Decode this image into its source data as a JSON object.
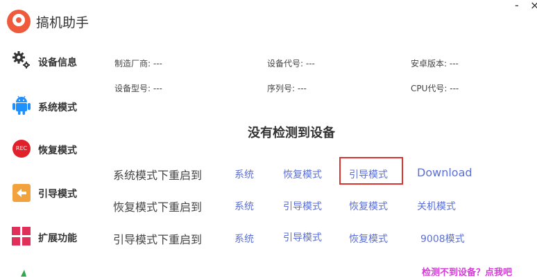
{
  "app": {
    "title": "搞机助手",
    "minimize": "-",
    "close": "×"
  },
  "sidebar": {
    "items": [
      {
        "label": "设备信息",
        "icon": "gears-icon"
      },
      {
        "label": "系统模式",
        "icon": "android-icon"
      },
      {
        "label": "恢复模式",
        "icon": "rec-icon",
        "icon_text": "REC"
      },
      {
        "label": "引导模式",
        "icon": "back-arrow-icon"
      },
      {
        "label": "扩展功能",
        "icon": "grid-icon"
      },
      {
        "label": "",
        "icon": "partial-icon"
      }
    ]
  },
  "device_info": {
    "manufacturer": "制造厂商: ---",
    "device_code": "设备代号: ---",
    "android_version": "安卓版本: ---",
    "model": "设备型号: ---",
    "serial": "序列号: ---",
    "cpu_code": "CPU代号: ---"
  },
  "status": {
    "no_device": "没有检测到设备"
  },
  "reboot_rows": [
    {
      "label": "系统模式下重启到",
      "options": [
        "系统",
        "恢复模式",
        "引导模式",
        "Download"
      ]
    },
    {
      "label": "恢复模式下重启到",
      "options": [
        "系统",
        "引导模式",
        "恢复模式",
        "关机模式"
      ]
    },
    {
      "label": "引导模式下重启到",
      "options": [
        "系统",
        "引导模式",
        "恢复模式",
        "9008模式"
      ]
    }
  ],
  "help": {
    "cannot_detect": "检测不到设备？点我吧"
  },
  "colors": {
    "accent": "#ef5a3c",
    "link": "#5b6fd6",
    "highlight": "#d9332b",
    "help": "#d63bd9"
  }
}
